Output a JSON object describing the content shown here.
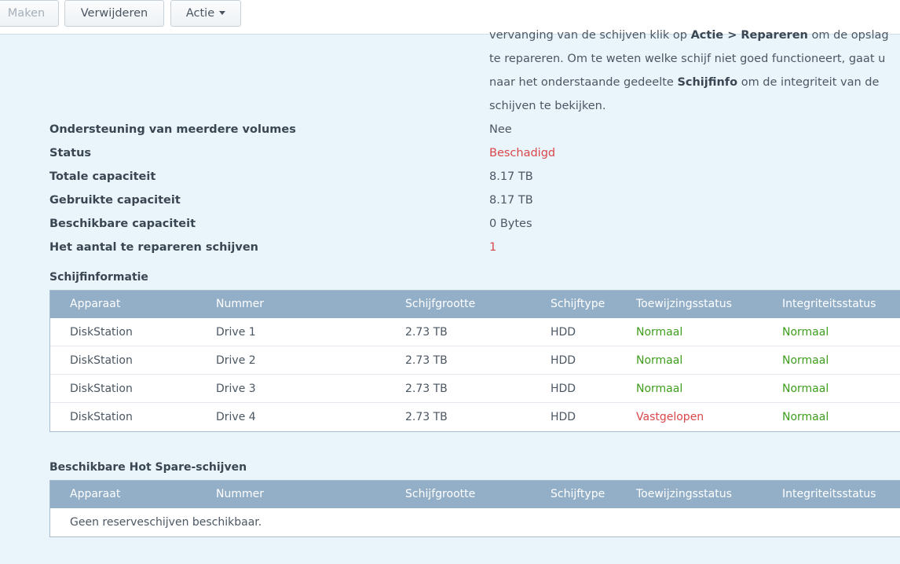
{
  "toolbar": {
    "create_label": "Maken",
    "delete_label": "Verwijderen",
    "action_label": "Actie"
  },
  "description": {
    "line1_pre": "vervanging van de schijven klik op ",
    "line1_bold1": "Actie",
    "line1_sep": " > ",
    "line1_bold2": "Repareren",
    "line1_post": " om de opslag",
    "line2": "te repareren. Om te weten welke schijf niet goed functioneert, gaat u",
    "line3_pre": "naar het onderstaande gedeelte ",
    "line3_bold": "Schijfinfo",
    "line3_post": " om de integriteit van de",
    "line4": "schijven te bekijken."
  },
  "properties": [
    {
      "label": "Ondersteuning van meerdere volumes",
      "value": "Nee"
    },
    {
      "label": "Status",
      "value": "Beschadigd"
    },
    {
      "label": "Totale capaciteit",
      "value": "8.17 TB"
    },
    {
      "label": "Gebruikte capaciteit",
      "value": "8.17 TB"
    },
    {
      "label": "Beschikbare capaciteit",
      "value": "0 Bytes"
    },
    {
      "label": "Het aantal te repareren schijven",
      "value": "1"
    }
  ],
  "disk_info": {
    "title": "Schijfinformatie",
    "columns": [
      "Apparaat",
      "Nummer",
      "Schijfgrootte",
      "Schijftype",
      "Toewijzingsstatus",
      "Integriteitsstatus"
    ],
    "rows": [
      [
        "DiskStation",
        "Drive 1",
        "2.73 TB",
        "HDD",
        "Normaal",
        "Normaal"
      ],
      [
        "DiskStation",
        "Drive 2",
        "2.73 TB",
        "HDD",
        "Normaal",
        "Normaal"
      ],
      [
        "DiskStation",
        "Drive 3",
        "2.73 TB",
        "HDD",
        "Normaal",
        "Normaal"
      ],
      [
        "DiskStation",
        "Drive 4",
        "2.73 TB",
        "HDD",
        "Vastgelopen",
        "Normaal"
      ]
    ]
  },
  "hot_spare": {
    "title": "Beschikbare Hot Spare-schijven",
    "columns": [
      "Apparaat",
      "Nummer",
      "Schijfgrootte",
      "Schijftype",
      "Toewijzingsstatus",
      "Integriteitsstatus"
    ],
    "empty_text": "Geen reserveschijven beschikbaar."
  },
  "colors": {
    "error": "#d9474b",
    "ok": "#3e9d1d",
    "grid_header": "#93afc7",
    "background": "#e9f4fb"
  }
}
